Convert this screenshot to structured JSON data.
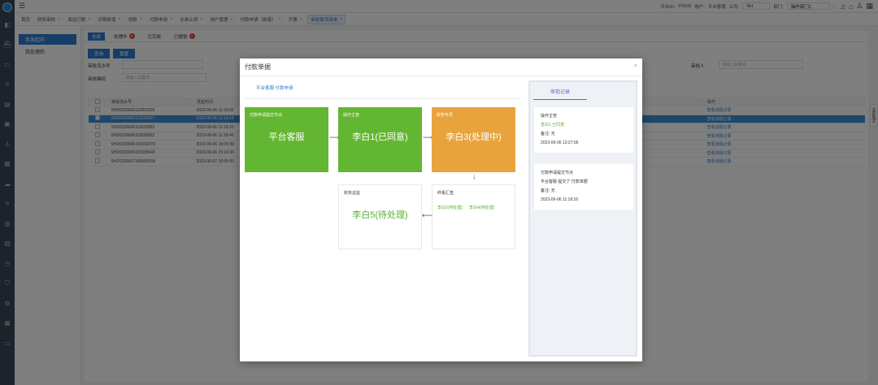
{
  "topbar": {
    "menu_icon": "menu-icon",
    "platform_id_label": "平台ID:",
    "platform_id": "P0005",
    "user_label": "用户:",
    "user": "平台客服",
    "company_label": "公司:",
    "company": "SH",
    "dept_label": "部门:",
    "dept": "操作部门1"
  },
  "tabs": [
    {
      "label": "首页",
      "closable": false
    },
    {
      "label": "财务审核",
      "closable": true
    },
    {
      "label": "海运订舱",
      "closable": true
    },
    {
      "label": "对账新增",
      "closable": true
    },
    {
      "label": "领款",
      "closable": true
    },
    {
      "label": "付款申请",
      "closable": true
    },
    {
      "label": "水单认领",
      "closable": true
    },
    {
      "label": "用户管理",
      "closable": true
    },
    {
      "label": "付款申请（新版）",
      "closable": true
    },
    {
      "label": "开票",
      "closable": true
    },
    {
      "label": "审批事项清单",
      "closable": true
    }
  ],
  "subnav": [
    {
      "label": "我发起的"
    },
    {
      "label": "我处理的"
    }
  ],
  "content_tabs": [
    {
      "label": "全部",
      "badge": ""
    },
    {
      "label": "处理中",
      "badge": "5"
    },
    {
      "label": "已完成",
      "badge": ""
    },
    {
      "label": "已撤销",
      "badge": "1"
    }
  ],
  "buttons": {
    "query": "查询",
    "reset": "重置"
  },
  "filters": {
    "serial_label": "审批流水号",
    "code_label": "审批编码",
    "code_placeholder": "请输入关键词",
    "approver_label": "审批人",
    "approver_placeholder": "请输入关键词"
  },
  "table": {
    "headers": [
      "审批流水号",
      "发起时间",
      "司",
      "发起人",
      "操作"
    ],
    "rows": [
      {
        "serial": "SH20230606111801529",
        "time": "2023-06-06 11:18:02",
        "initiator": "平台客服",
        "action": "查看流程记录"
      },
      {
        "serial": "SH20230606111816027",
        "time": "2023-06-06 11:18:16",
        "initiator": "平台客服",
        "action": "查看流程记录"
      },
      {
        "serial": "SH20230606111832992",
        "time": "2023-06-06 11:18:33",
        "initiator": "平台客服",
        "action": "查看流程记录"
      },
      {
        "serial": "SH20230606111839653",
        "time": "2023-06-06 11:18:40",
        "initiator": "平台客服",
        "action": "查看流程记录"
      },
      {
        "serial": "SH20230606150939278",
        "time": "2023-06-06 15:09:39",
        "initiator": "平台客服",
        "action": "查看流程记录"
      },
      {
        "serial": "SH20230606151935640",
        "time": "2023-06-06 15:19:36",
        "initiator": "平台客服",
        "action": "查看流程记录"
      },
      {
        "serial": "SH20230607105505158",
        "time": "2023-06-07 10:55:05",
        "initiator": "平台客服",
        "action": "查看流程记录"
      }
    ]
  },
  "sidetab_label": "全部展开",
  "modal": {
    "title": "付款单据",
    "flow_tab": "平台客服 付款申请",
    "nodes": [
      {
        "title": "付款申请提交节点",
        "name": "平台客服"
      },
      {
        "title": "操作主管",
        "name": "李白1(已同意)"
      },
      {
        "title": "财务专员",
        "name": "李白3(处理中)"
      },
      {
        "title": "财务总监",
        "name": "李白5(待处理)"
      },
      {
        "title": "终极汇签",
        "subs": [
          "李白2(待处理)",
          "李白4(待处理)"
        ]
      }
    ],
    "records_tab": "审批记录",
    "records": [
      {
        "title": "操作主管",
        "detail": "李白1 已同意",
        "note": "备注: 无",
        "time": "2023-06-06 13:27:05"
      },
      {
        "title": "付款申请提交节点",
        "detail": "平台客服 提交了 付款单据",
        "note": "备注: 无",
        "time": "2023-06-06 11:18:16"
      }
    ]
  },
  "colors": {
    "primary": "#2b7bd0",
    "node_done": "#63b631",
    "node_active": "#e9a33c",
    "pending_text": "#5cb035",
    "badge": "#e0463c"
  }
}
